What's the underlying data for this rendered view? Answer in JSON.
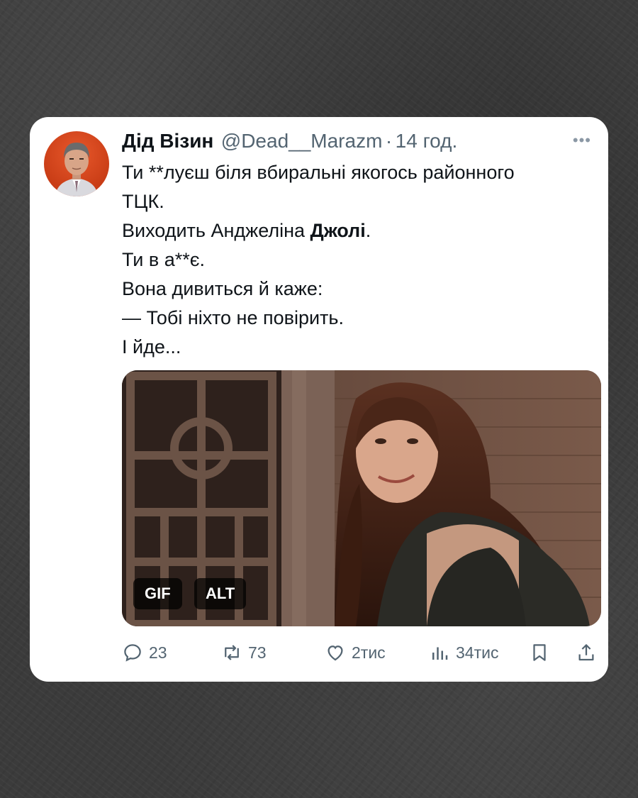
{
  "tweet": {
    "author_name": "Дід Візин",
    "handle": "@Dead__Marazm",
    "separator": "·",
    "time": "14 год.",
    "more_icon": "more-horizontal-icon",
    "lines": [
      "Ти  **луєш біля вбиральні якогось районного",
      "ТЦК.",
      "Виходить Анджеліна ",
      "Ти в а**є.",
      "Вона дивиться й каже:",
      "— Тобі ніхто не повірить.",
      "І йде..."
    ],
    "bold_word": "Джолі",
    "bold_suffix": "."
  },
  "media": {
    "gif_badge": "GIF",
    "alt_badge": "ALT"
  },
  "actions": {
    "replies": "23",
    "reposts": "73",
    "likes": "2тис",
    "views": "34тис"
  },
  "colors": {
    "background": "#3b3b3b",
    "card": "#ffffff",
    "text": "#0f1419",
    "muted": "#536471"
  }
}
